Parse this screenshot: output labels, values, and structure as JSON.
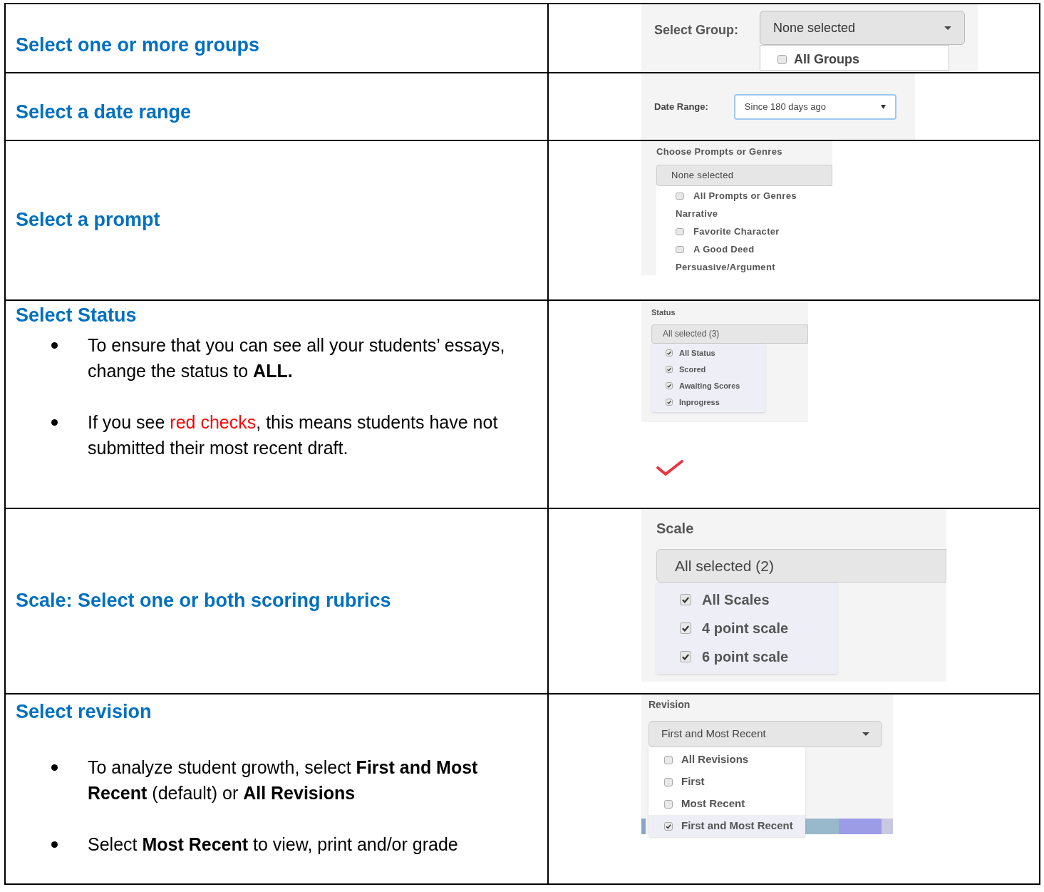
{
  "rows": [
    {
      "heading": "Select one or more groups",
      "widget": {
        "kind": "group",
        "label": "Select Group:",
        "value": "None selected",
        "caret": true,
        "options": [
          {
            "kind": "checkbox",
            "label": "All Groups",
            "checked": false
          }
        ]
      }
    },
    {
      "heading": "Select a date range",
      "widget": {
        "kind": "date",
        "label": "Date Range:",
        "value": "Since 180 days ago",
        "caret": true
      }
    },
    {
      "heading": "Select a prompt",
      "widget": {
        "kind": "prompt",
        "label": "Choose Prompts or Genres",
        "value": "None selected",
        "caret": false,
        "options": [
          {
            "kind": "checkbox",
            "label": "All Prompts or Genres",
            "checked": false
          },
          {
            "kind": "group",
            "label": "Narrative"
          },
          {
            "kind": "checkbox",
            "label": "Favorite Character",
            "checked": false
          },
          {
            "kind": "checkbox",
            "label": "A Good Deed",
            "checked": false
          },
          {
            "kind": "group",
            "label": "Persuasive/Argument"
          }
        ]
      }
    },
    {
      "heading": "Select Status",
      "bullets": [
        [
          {
            "text": "To ensure that you can see all your students’ essays, change the status to **ALL.**"
          }
        ],
        [
          {
            "text": "If you see "
          },
          {
            "text": "red checks",
            "color": "#ff0000"
          },
          {
            "text": ", this means students have not submitted their most recent draft."
          }
        ]
      ],
      "widget": {
        "kind": "status",
        "label": "Status",
        "value": "All selected (3)",
        "caret": false,
        "options": [
          {
            "kind": "checkbox",
            "label": "All Status",
            "checked": true
          },
          {
            "kind": "checkbox",
            "label": "Scored",
            "checked": true
          },
          {
            "kind": "checkbox",
            "label": "Awaiting Scores",
            "checked": true
          },
          {
            "kind": "checkbox",
            "label": "Inprogress",
            "checked": true
          }
        ]
      },
      "mark": {
        "kind": "red_check",
        "color": "#e8343f"
      }
    },
    {
      "heading": "Scale: Select one or both scoring rubrics",
      "widget": {
        "kind": "scale",
        "label": "Scale",
        "value": "All selected (2)",
        "caret": false,
        "options": [
          {
            "kind": "checkbox",
            "label": "All Scales",
            "checked": true
          },
          {
            "kind": "checkbox",
            "label": "4 point scale",
            "checked": true
          },
          {
            "kind": "checkbox",
            "label": "6 point scale",
            "checked": true
          }
        ]
      }
    },
    {
      "heading": "Select revision",
      "bullets": [
        [
          {
            "text": "To analyze student growth, select **First and Most Recent** (default) or **All Revisions**"
          }
        ],
        [
          {
            "text": "Select **Most Recent** to view, print and/or grade"
          }
        ]
      ],
      "widget": {
        "kind": "revision",
        "label": "Revision",
        "value": "First and Most Recent",
        "caret": true,
        "options": [
          {
            "kind": "checkbox",
            "label": "All Revisions",
            "checked": false,
            "selected": false
          },
          {
            "kind": "checkbox",
            "label": "First",
            "checked": false,
            "selected": false
          },
          {
            "kind": "checkbox",
            "label": "Most Recent",
            "checked": false,
            "selected": false
          },
          {
            "kind": "checkbox",
            "label": "First and Most Recent",
            "checked": true,
            "selected": true
          }
        ]
      }
    }
  ]
}
